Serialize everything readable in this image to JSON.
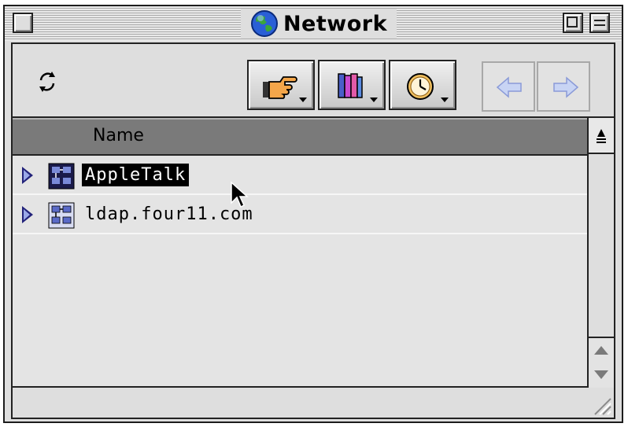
{
  "window": {
    "title": "Network"
  },
  "toolbar": {
    "refresh_icon": "refresh-arrows-icon",
    "buttons": [
      {
        "name": "pointing-hand-icon"
      },
      {
        "name": "books-icon"
      },
      {
        "name": "clock-icon"
      }
    ],
    "nav": {
      "back_icon": "back-arrow-icon",
      "forward_icon": "forward-arrow-icon"
    }
  },
  "list": {
    "column_header": "Name",
    "rows": [
      {
        "label": "AppleTalk",
        "selected": true
      },
      {
        "label": "ldap.four11.com",
        "selected": false
      }
    ]
  },
  "colors": {
    "selection": "#000000",
    "header": "#7a7a7a",
    "disclosure": "#22227a"
  }
}
